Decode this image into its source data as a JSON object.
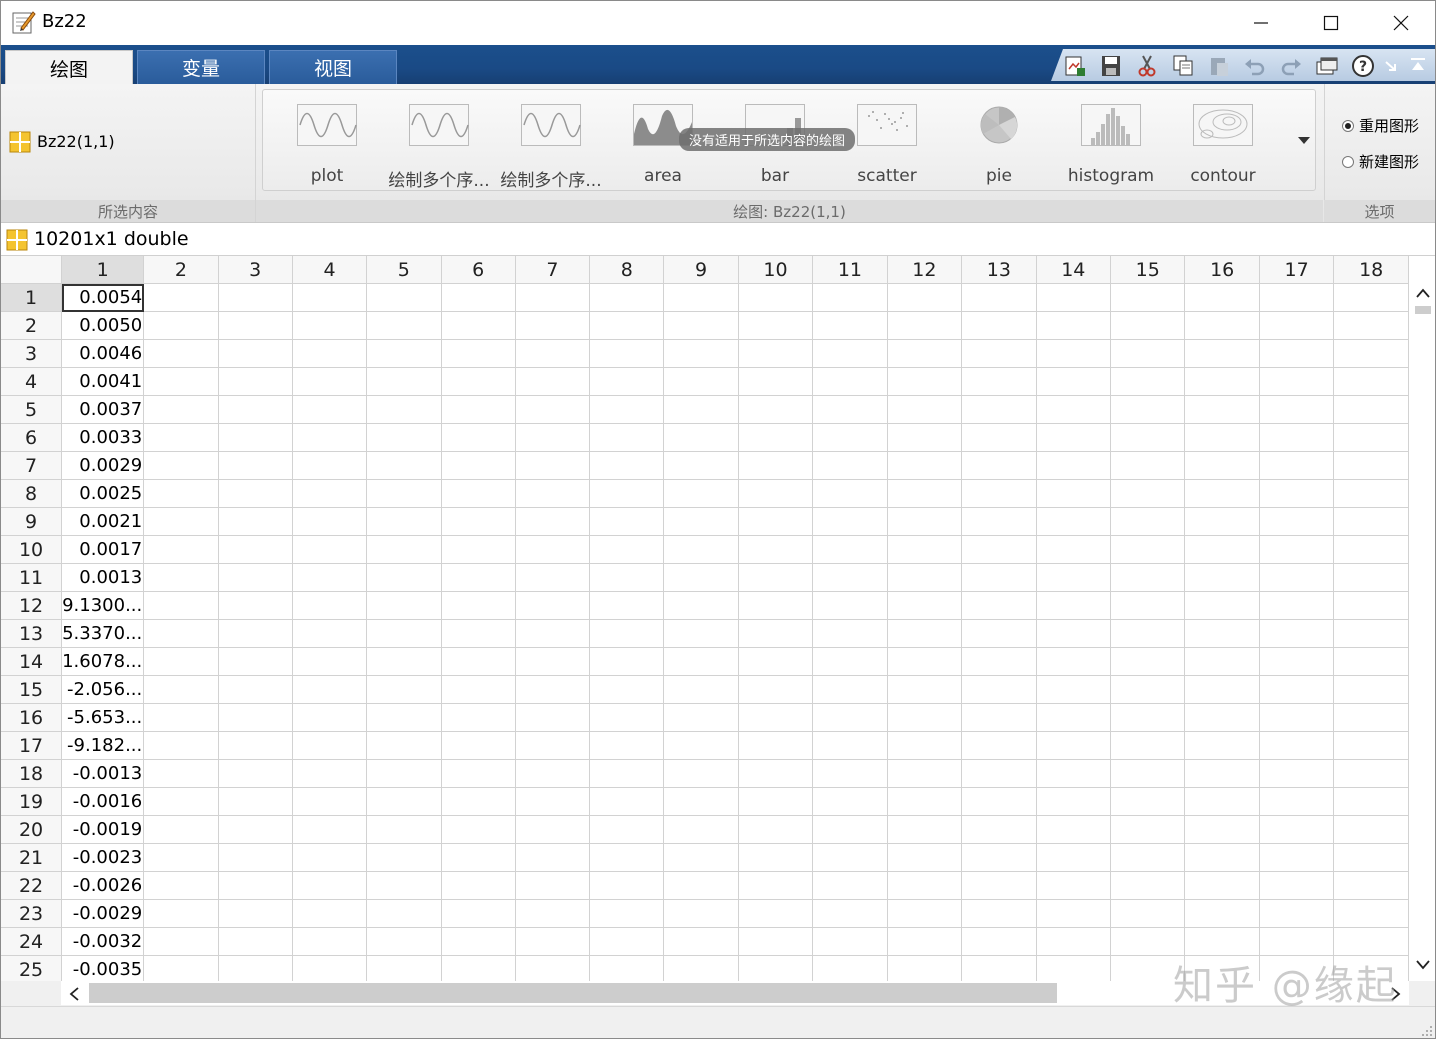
{
  "window": {
    "title": "Bz22"
  },
  "tabs": [
    {
      "label": "绘图",
      "active": true
    },
    {
      "label": "变量",
      "active": false
    },
    {
      "label": "视图",
      "active": false
    }
  ],
  "ribbon": {
    "selection": {
      "text": "Bz22(1,1)",
      "group_label": "所选内容"
    },
    "plots": {
      "group_label": "绘图: Bz22(1,1)",
      "tooltip": "没有适用于所选内容的绘图",
      "items": [
        "plot",
        "绘制多个序...",
        "绘制多个序...",
        "area",
        "bar",
        "scatter",
        "pie",
        "histogram",
        "contour"
      ]
    },
    "options": {
      "group_label": "选项",
      "radios": [
        {
          "label": "重用图形",
          "checked": true
        },
        {
          "label": "新建图形",
          "checked": false
        }
      ]
    }
  },
  "variable": {
    "label": "10201x1 double"
  },
  "grid": {
    "columns": [
      "1",
      "2",
      "3",
      "4",
      "5",
      "6",
      "7",
      "8",
      "9",
      "10",
      "11",
      "12",
      "13",
      "14",
      "15",
      "16",
      "17",
      "18"
    ],
    "rows": [
      {
        "n": "1",
        "v": "0.0054"
      },
      {
        "n": "2",
        "v": "0.0050"
      },
      {
        "n": "3",
        "v": "0.0046"
      },
      {
        "n": "4",
        "v": "0.0041"
      },
      {
        "n": "5",
        "v": "0.0037"
      },
      {
        "n": "6",
        "v": "0.0033"
      },
      {
        "n": "7",
        "v": "0.0029"
      },
      {
        "n": "8",
        "v": "0.0025"
      },
      {
        "n": "9",
        "v": "0.0021"
      },
      {
        "n": "10",
        "v": "0.0017"
      },
      {
        "n": "11",
        "v": "0.0013"
      },
      {
        "n": "12",
        "v": "9.1300..."
      },
      {
        "n": "13",
        "v": "5.3370..."
      },
      {
        "n": "14",
        "v": "1.6078..."
      },
      {
        "n": "15",
        "v": "-2.056..."
      },
      {
        "n": "16",
        "v": "-5.653..."
      },
      {
        "n": "17",
        "v": "-9.182..."
      },
      {
        "n": "18",
        "v": "-0.0013"
      },
      {
        "n": "19",
        "v": "-0.0016"
      },
      {
        "n": "20",
        "v": "-0.0019"
      },
      {
        "n": "21",
        "v": "-0.0023"
      },
      {
        "n": "22",
        "v": "-0.0026"
      },
      {
        "n": "23",
        "v": "-0.0029"
      },
      {
        "n": "24",
        "v": "-0.0032"
      },
      {
        "n": "25",
        "v": "-0.0035"
      }
    ]
  },
  "watermark": "知乎 @缘起",
  "icons": {
    "app": "variable-editor-icon",
    "window_controls": [
      "minimize-icon",
      "maximize-icon",
      "close-icon"
    ],
    "quick_access": [
      "new-figure-icon",
      "save-icon",
      "cut-icon",
      "copy-icon",
      "paste-icon",
      "undo-icon",
      "redo-icon",
      "switch-windows-icon",
      "help-icon",
      "minimize-ribbon-icon",
      "collapse-icon"
    ]
  }
}
